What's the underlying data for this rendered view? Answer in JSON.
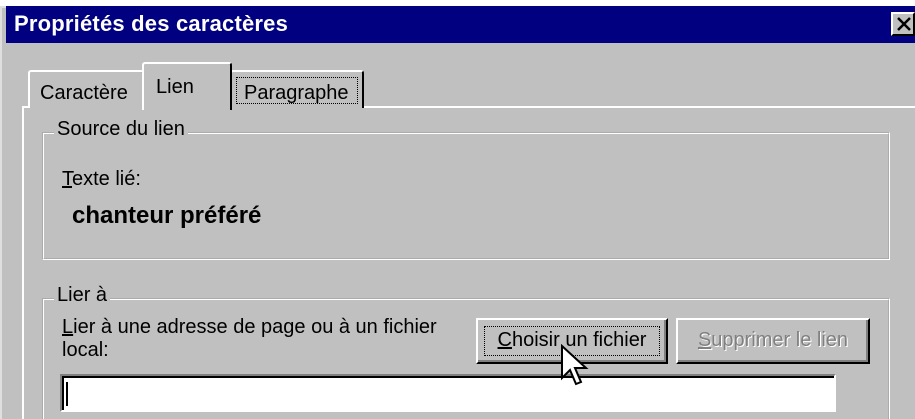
{
  "window": {
    "title": "Propriétés des caractères",
    "colors": {
      "titlebar": "#000080",
      "face": "#c0c0c0",
      "disabled_text": "#808080"
    }
  },
  "tabs": [
    {
      "label": "Caractère",
      "active": false
    },
    {
      "label": "Lien",
      "active": true
    },
    {
      "label": "Paragraphe",
      "active": false
    }
  ],
  "source": {
    "legend": "Source du lien",
    "texte_lie_label_rest": "exte lié:",
    "texte_lie_accel": "T",
    "linked_text": "chanteur préféré"
  },
  "lier": {
    "legend": "Lier à",
    "instruction": "Lier à une adresse de page ou à un fichier local:",
    "choose_file_button": {
      "accel": "C",
      "rest": "hoisir un fichier"
    },
    "remove_link_button": {
      "accel": "S",
      "rest": "upprimer le lien",
      "enabled": false
    },
    "url_value": ""
  },
  "icons": {
    "close": "close-icon",
    "cursor": "arrow-cursor-icon"
  }
}
